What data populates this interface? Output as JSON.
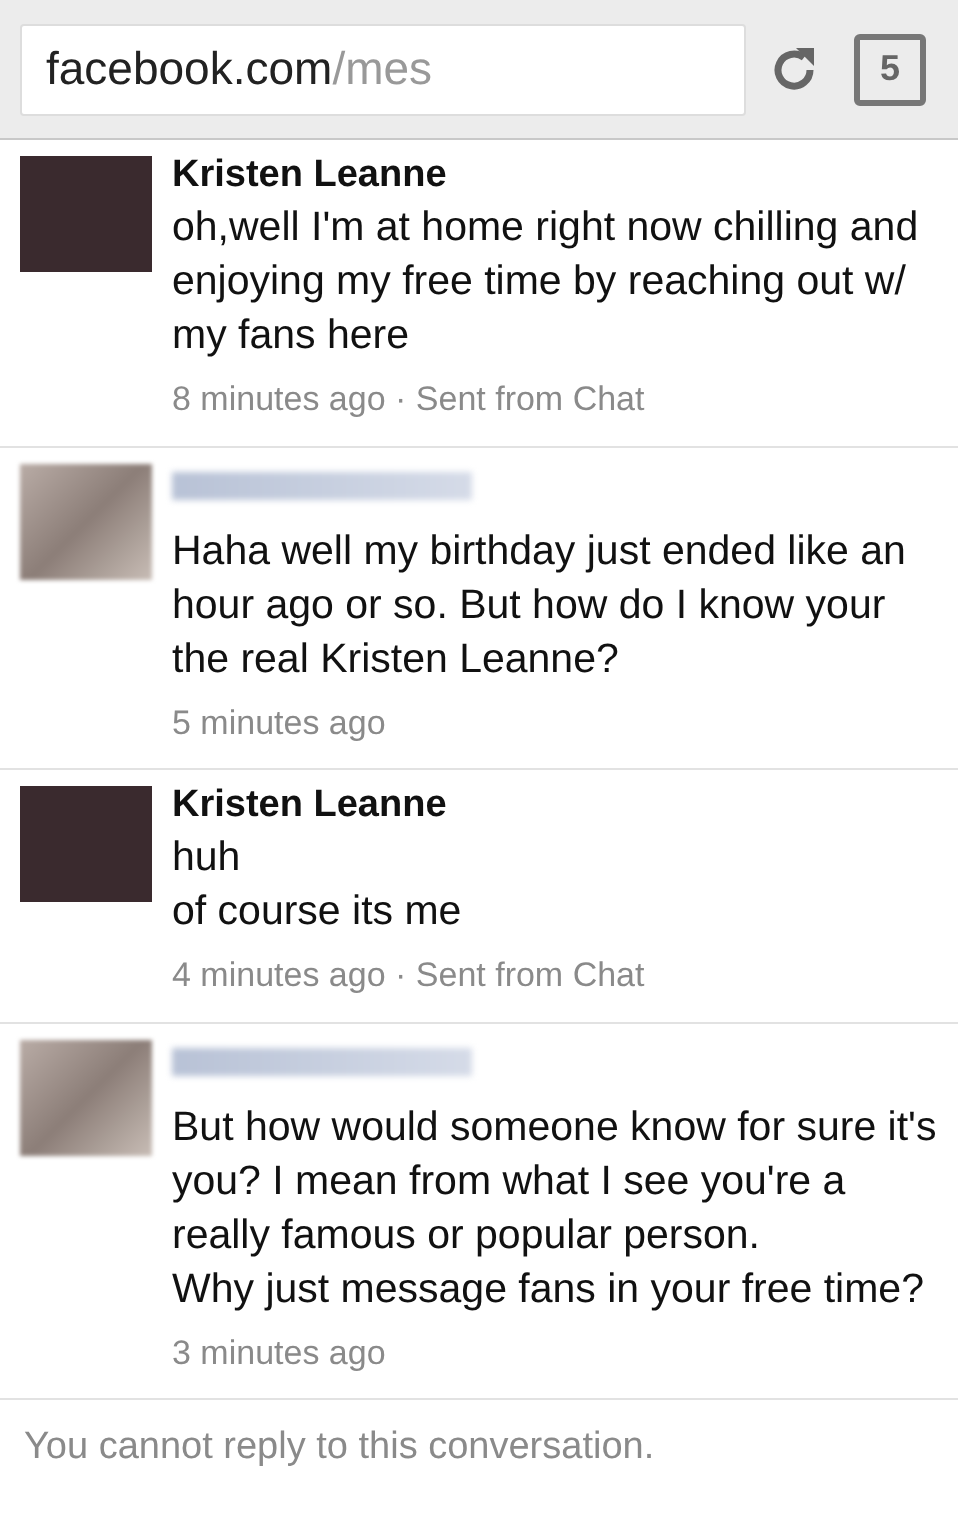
{
  "browser": {
    "url_domain": "facebook.com",
    "url_path": "/mes",
    "tab_count": "5"
  },
  "messages": [
    {
      "sender": {
        "kind": "named",
        "name": "Kristen Leanne"
      },
      "avatar_blurred": false,
      "paragraphs": [
        "oh,well I'm at home right now chilling and enjoying my free time by reaching out w/ my fans here"
      ],
      "meta": "8 minutes ago · Sent from Chat"
    },
    {
      "sender": {
        "kind": "redacted"
      },
      "avatar_blurred": true,
      "paragraphs": [
        "Haha well my birthday just ended like an hour ago or so. But how do I know your the real Kristen Leanne?"
      ],
      "meta": "5 minutes ago"
    },
    {
      "sender": {
        "kind": "named",
        "name": "Kristen Leanne"
      },
      "avatar_blurred": false,
      "paragraphs": [
        "huh",
        "of course its me"
      ],
      "meta": "4 minutes ago · Sent from Chat"
    },
    {
      "sender": {
        "kind": "redacted"
      },
      "avatar_blurred": true,
      "paragraphs": [
        "But how would someone know for sure it's you? I mean from what I see you're a really famous or popular person.",
        "Why just message fans in your free time?"
      ],
      "meta": "3 minutes ago"
    }
  ],
  "footer": "You cannot reply to this conversation."
}
